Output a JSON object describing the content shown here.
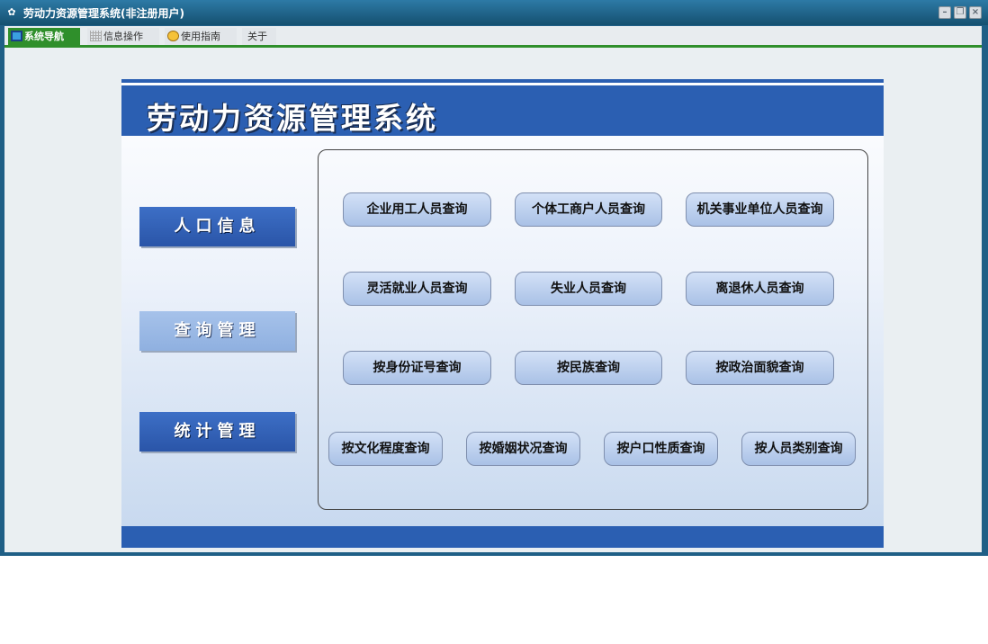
{
  "window": {
    "title": "劳动力资源管理系统(非注册用户)",
    "app_icon": "app-logo-icon",
    "controls": {
      "minimize": "minimize-icon",
      "restore": "restore-icon",
      "close": "close-icon"
    }
  },
  "tabs": [
    {
      "label": "系统导航",
      "icon": "monitor-icon",
      "active": true
    },
    {
      "label": "信息操作",
      "icon": "grid-icon",
      "active": false
    },
    {
      "label": "使用指南",
      "icon": "help-circle-icon",
      "active": false
    },
    {
      "label": "关于",
      "icon": "",
      "active": false
    }
  ],
  "panel": {
    "header_title": "劳动力资源管理系统"
  },
  "sidebar": [
    {
      "label": "人口信息",
      "style": "dark"
    },
    {
      "label": "查询管理",
      "style": "light"
    },
    {
      "label": "统计管理",
      "style": "dark"
    }
  ],
  "queries": {
    "row1": [
      "企业用工人员查询",
      "个体工商户人员查询",
      "机关事业单位人员查询"
    ],
    "row2": [
      "灵活就业人员查询",
      "失业人员查询",
      "离退休人员查询"
    ],
    "row3": [
      "按身份证号查询",
      "按民族查询",
      "按政治面貌查询"
    ],
    "row4": [
      "按文化程度查询",
      "按婚姻状况查询",
      "按户口性质查询",
      "按人员类别查询"
    ]
  },
  "colors": {
    "title_bar": "#1f5f86",
    "active_tab": "#2f8f2b",
    "header_blue": "#2b5fb2",
    "button_face": "#b9cdee"
  }
}
